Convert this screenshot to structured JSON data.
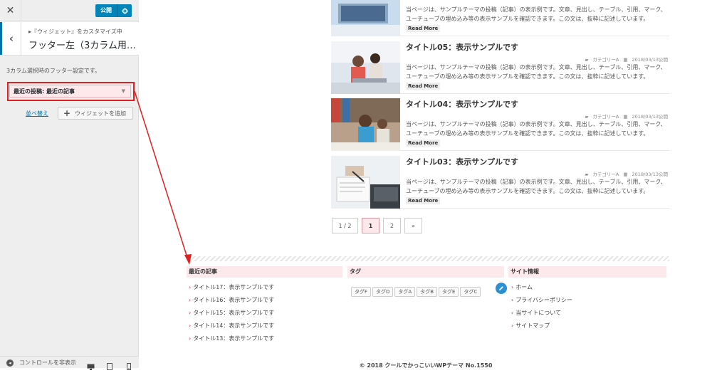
{
  "sidebar": {
    "publish_label": "公開",
    "crumb": "『ウィジェット』をカスタマイズ中",
    "title": "フッター左（3カラム用…",
    "description": "3カラム選択時のフッター設定です。",
    "widget_title": "最近の投稿: 最近の記事",
    "reorder_label": "並べ替え",
    "add_widget_label": "ウィジェットを追加",
    "collapse_label": "コントロールを非表示"
  },
  "posts": [
    {
      "title": "",
      "category": "",
      "date": "",
      "excerpt": "当ページは、サンプルテーマの投稿（記事）の表示例です。文章、見出し、テーブル、引用、マーク、ユーチューブの埋め込み等の表示サンプルを確認できます。この文は、抜粋に記述しています。",
      "more": "Read More"
    },
    {
      "title": "タイトル05：表示サンプルです",
      "category": "カテゴリーA",
      "date": "2018/03/13公開",
      "excerpt": "当ページは、サンプルテーマの投稿（記事）の表示例です。文章、見出し、テーブル、引用、マーク、ユーチューブの埋め込み等の表示サンプルを確認できます。この文は、抜粋に記述しています。",
      "more": "Read More"
    },
    {
      "title": "タイトル04：表示サンプルです",
      "category": "カテゴリーA",
      "date": "2018/03/13公開",
      "excerpt": "当ページは、サンプルテーマの投稿（記事）の表示例です。文章、見出し、テーブル、引用、マーク、ユーチューブの埋め込み等の表示サンプルを確認できます。この文は、抜粋に記述しています。",
      "more": "Read More"
    },
    {
      "title": "タイトル03：表示サンプルです",
      "category": "カテゴリーA",
      "date": "2018/03/13公開",
      "excerpt": "当ページは、サンプルテーマの投稿（記事）の表示例です。文章、見出し、テーブル、引用、マーク、ユーチューブの埋め込み等の表示サンプルを確認できます。この文は、抜粋に記述しています。",
      "more": "Read More"
    }
  ],
  "pagination": {
    "info": "1 / 2",
    "current": "1",
    "next_page": "2",
    "next": "»"
  },
  "footer": {
    "recent": {
      "heading": "最近の記事",
      "items": [
        "タイトル17：表示サンプルです",
        "タイトル16：表示サンプルです",
        "タイトル15：表示サンプルです",
        "タイトル14：表示サンプルです",
        "タイトル13：表示サンプルです"
      ]
    },
    "tags": {
      "heading": "タグ",
      "items": [
        "タグF",
        "タグD",
        "タグA",
        "タグB",
        "タグE",
        "タグC"
      ]
    },
    "site": {
      "heading": "サイト情報",
      "items": [
        "ホーム",
        "プライバシーポリシー",
        "当サイトについて",
        "サイトマップ"
      ]
    },
    "copyright": "© 2018 クールでかっこいいWPテーマ No.1550"
  },
  "colors": {
    "accent_blue": "#0085ba",
    "highlight_red": "#e02020",
    "pink_bg": "#fde8ec"
  }
}
